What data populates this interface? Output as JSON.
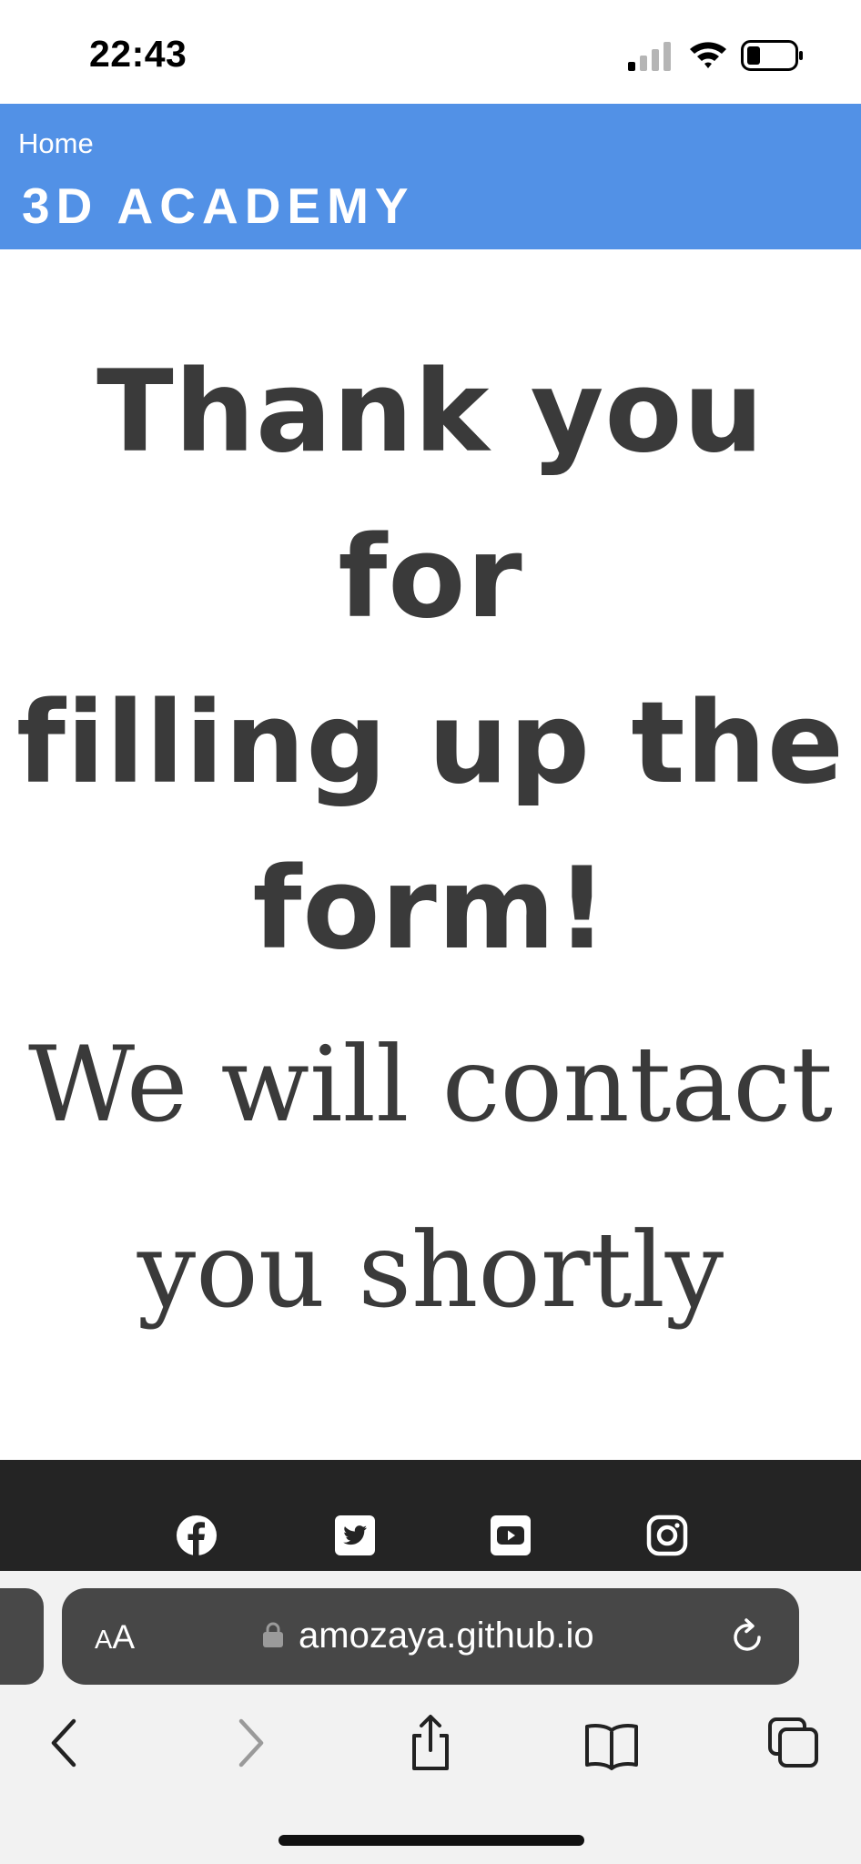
{
  "status_bar": {
    "time": "22:43"
  },
  "header": {
    "home_link": "Home",
    "brand": "3D ACADEMY",
    "color": "#5291e6"
  },
  "main": {
    "heading_lines": [
      "Thank you for",
      "filling up the",
      "form!"
    ],
    "message_lines": [
      "We will contact",
      "you shortly"
    ]
  },
  "footer": {
    "social_icons": [
      "facebook-icon",
      "twitter-icon",
      "youtube-icon",
      "instagram-icon"
    ]
  },
  "browser": {
    "aa_small": "A",
    "aa_large": "A",
    "url": "amozaya.github.io",
    "toolbar_icons": [
      "back-icon",
      "forward-icon",
      "share-icon",
      "bookmarks-icon",
      "tabs-icon"
    ]
  }
}
